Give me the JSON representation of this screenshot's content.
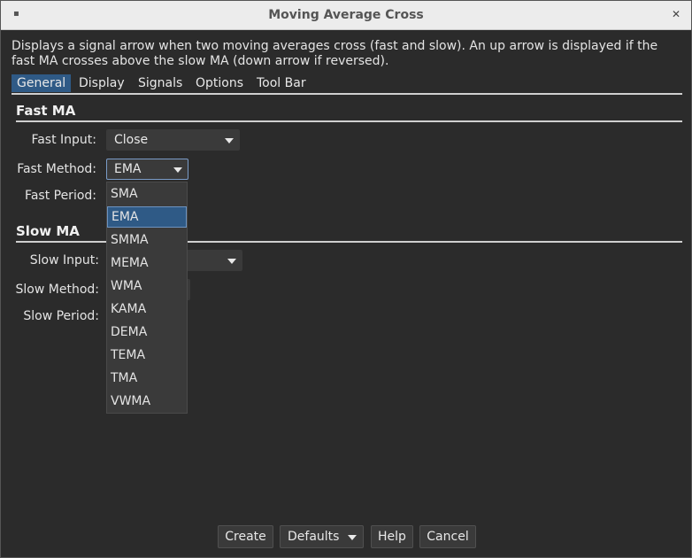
{
  "window": {
    "title": "Moving Average Cross",
    "menu_icon": "window-menu-icon",
    "close_icon": "close-icon"
  },
  "description": "Displays a signal arrow when two moving averages cross (fast and slow).  An up arrow is displayed if the fast MA crosses above the slow MA (down arrow if reversed).",
  "tabs": [
    {
      "label": "General",
      "active": true
    },
    {
      "label": "Display",
      "active": false
    },
    {
      "label": "Signals",
      "active": false
    },
    {
      "label": "Options",
      "active": false
    },
    {
      "label": "Tool Bar",
      "active": false
    }
  ],
  "fast_ma": {
    "title": "Fast MA",
    "input_label": "Fast Input:",
    "input_value": "Close",
    "method_label": "Fast Method:",
    "method_value": "EMA",
    "period_label": "Fast Period:"
  },
  "slow_ma": {
    "title": "Slow MA",
    "input_label": "Slow Input:",
    "method_label": "Slow Method:",
    "period_label": "Slow Period:"
  },
  "method_dropdown": {
    "options": [
      "SMA",
      "EMA",
      "SMMA",
      "MEMA",
      "WMA",
      "KAMA",
      "DEMA",
      "TEMA",
      "TMA",
      "VWMA"
    ],
    "selected": "EMA"
  },
  "buttons": {
    "create": "Create",
    "defaults": "Defaults",
    "help": "Help",
    "cancel": "Cancel"
  },
  "colors": {
    "accent": "#2f5a86",
    "background": "#2b2b2b",
    "titlebar": "#ececec"
  }
}
